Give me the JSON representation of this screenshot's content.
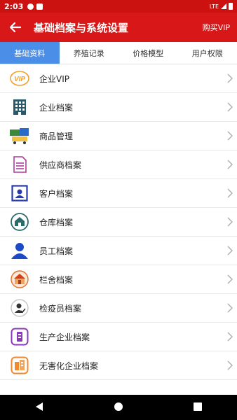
{
  "status": {
    "time": "2:03",
    "network": "LTE"
  },
  "header": {
    "title": "基础档案与系统设置",
    "buy_vip": "购买VIP"
  },
  "tabs": [
    {
      "label": "基础资料"
    },
    {
      "label": "养殖记录"
    },
    {
      "label": "价格模型"
    },
    {
      "label": "用户权限"
    }
  ],
  "items": [
    {
      "label": "企业VIP",
      "icon": "vip-icon",
      "color": "#f0a030"
    },
    {
      "label": "企业档案",
      "icon": "building-icon",
      "color": "#2a5a6a"
    },
    {
      "label": "商品管理",
      "icon": "goods-icon",
      "color": "#3a8a3a"
    },
    {
      "label": "供应商档案",
      "icon": "document-icon",
      "color": "#b03aa0"
    },
    {
      "label": "客户档案",
      "icon": "contact-card-icon",
      "color": "#2a3aa8"
    },
    {
      "label": "仓库档案",
      "icon": "warehouse-icon",
      "color": "#2a6a6a"
    },
    {
      "label": "员工档案",
      "icon": "person-icon",
      "color": "#1a4ac8"
    },
    {
      "label": "栏舍档案",
      "icon": "barn-icon",
      "color": "#e07030"
    },
    {
      "label": "检疫员档案",
      "icon": "inspector-icon",
      "color": "#333333"
    },
    {
      "label": "生产企业档案",
      "icon": "factory-doc-icon",
      "color": "#8a3ab8"
    },
    {
      "label": "无害化企业档案",
      "icon": "disposal-building-icon",
      "color": "#f08a30"
    }
  ],
  "colors": {
    "header": "#d81818",
    "statusbar": "#cc1111",
    "active_tab": "#4a8ee8"
  }
}
